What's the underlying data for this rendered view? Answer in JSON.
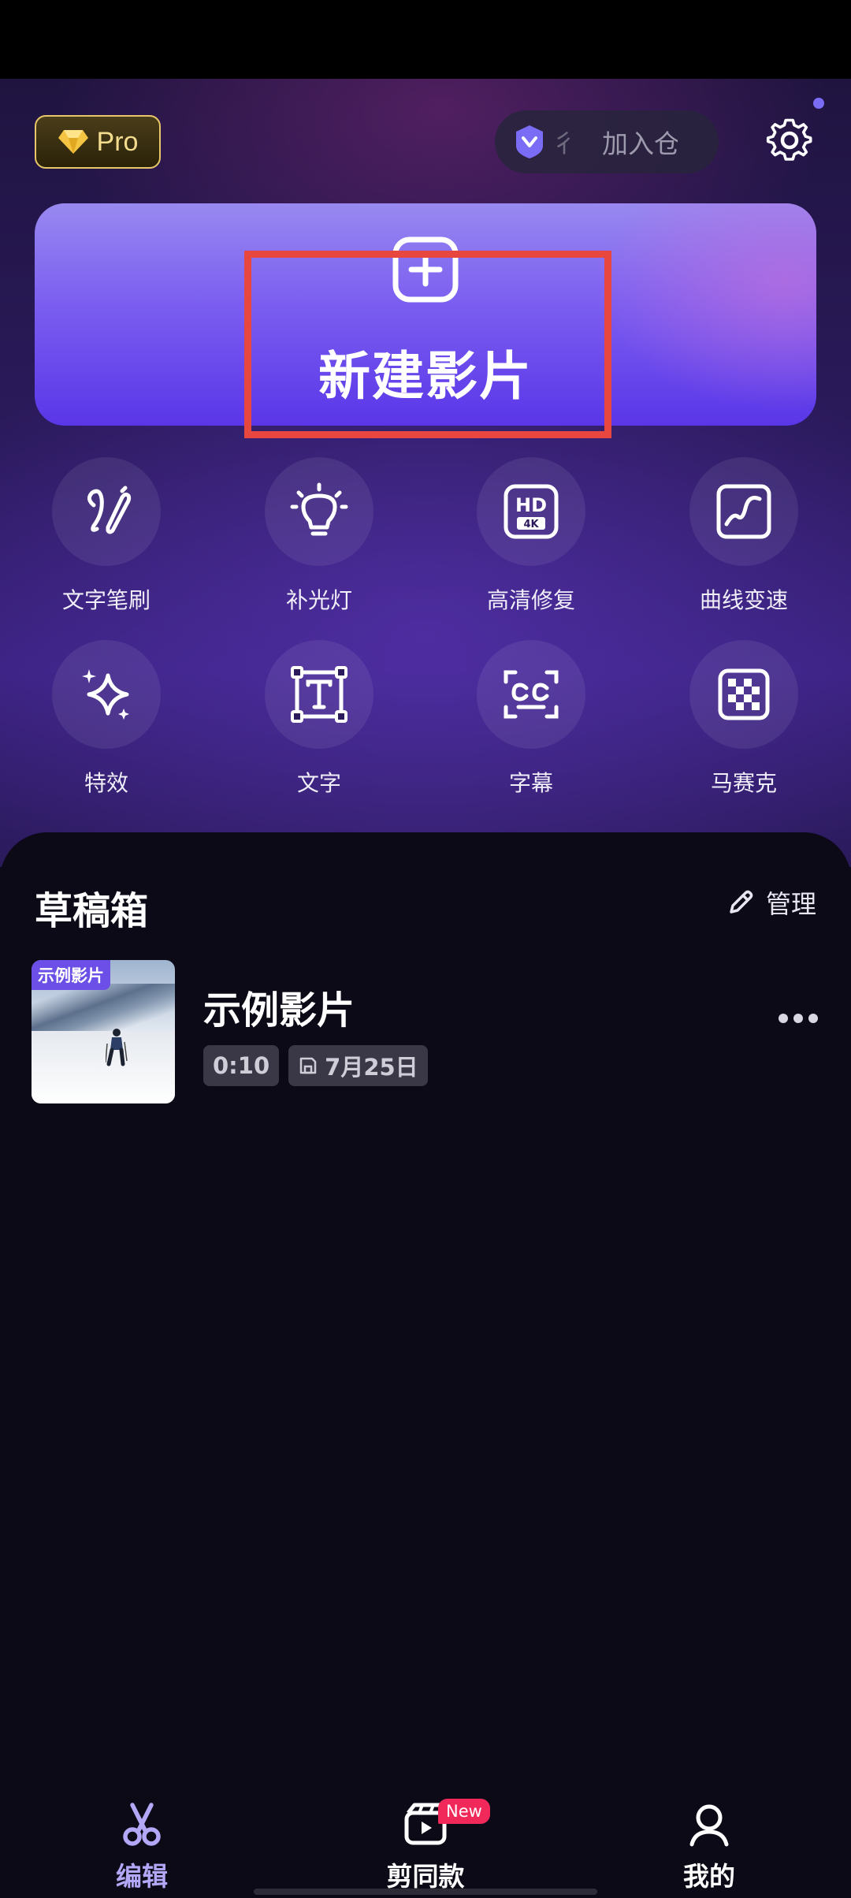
{
  "header": {
    "pro_label": "Pro",
    "join_partial": "彳",
    "join_label": "加入仓"
  },
  "new_project": {
    "label": "新建影片"
  },
  "tools": [
    {
      "label": "文字笔刷",
      "icon": "brush-icon"
    },
    {
      "label": "补光灯",
      "icon": "light-bulb-icon"
    },
    {
      "label": "高清修复",
      "icon": "hd-4k-icon"
    },
    {
      "label": "曲线变速",
      "icon": "curve-speed-icon"
    },
    {
      "label": "特效",
      "icon": "sparkle-icon"
    },
    {
      "label": "文字",
      "icon": "text-icon"
    },
    {
      "label": "字幕",
      "icon": "caption-icon"
    },
    {
      "label": "马赛克",
      "icon": "mosaic-icon"
    }
  ],
  "drafts": {
    "title": "草稿箱",
    "manage_label": "管理",
    "items": [
      {
        "tag": "示例影片",
        "name": "示例影片",
        "duration": "0:10",
        "date": "7月25日"
      }
    ]
  },
  "bottom_nav": [
    {
      "label": "编辑",
      "icon": "scissors-icon",
      "active": true
    },
    {
      "label": "剪同款",
      "icon": "template-video-icon",
      "badge": "New"
    },
    {
      "label": "我的",
      "icon": "profile-icon"
    }
  ],
  "colors": {
    "accent": "#6b4fe6",
    "active_nav": "#b3a7f7",
    "highlight_box": "#e8473f",
    "badge": "#f0295a"
  }
}
